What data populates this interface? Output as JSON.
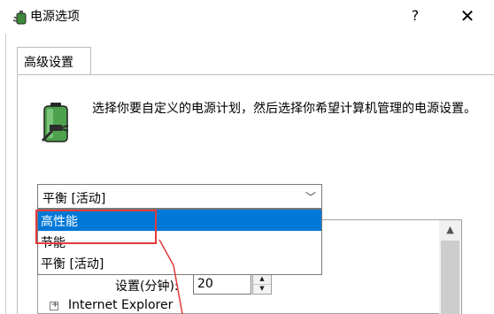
{
  "window": {
    "title": "电源选项",
    "help_label": "?",
    "close_label": "✕",
    "icon": "power-options-icon"
  },
  "tabs": [
    {
      "label": "高级设置",
      "active": true
    }
  ],
  "description": "选择你要自定义的电源计划，然后选择你希望计算机管理的电源设置。",
  "plan_select": {
    "value": "平衡 [活动]",
    "options": [
      "高性能",
      "节能",
      "平衡 [活动]"
    ],
    "highlighted_index": 0
  },
  "settings": {
    "field_label": "设置(分钟):",
    "field_value": "20",
    "tree_item": "Internet Explorer"
  },
  "colors": {
    "highlight": "#0078d7",
    "annotation": "#e23a3a"
  }
}
